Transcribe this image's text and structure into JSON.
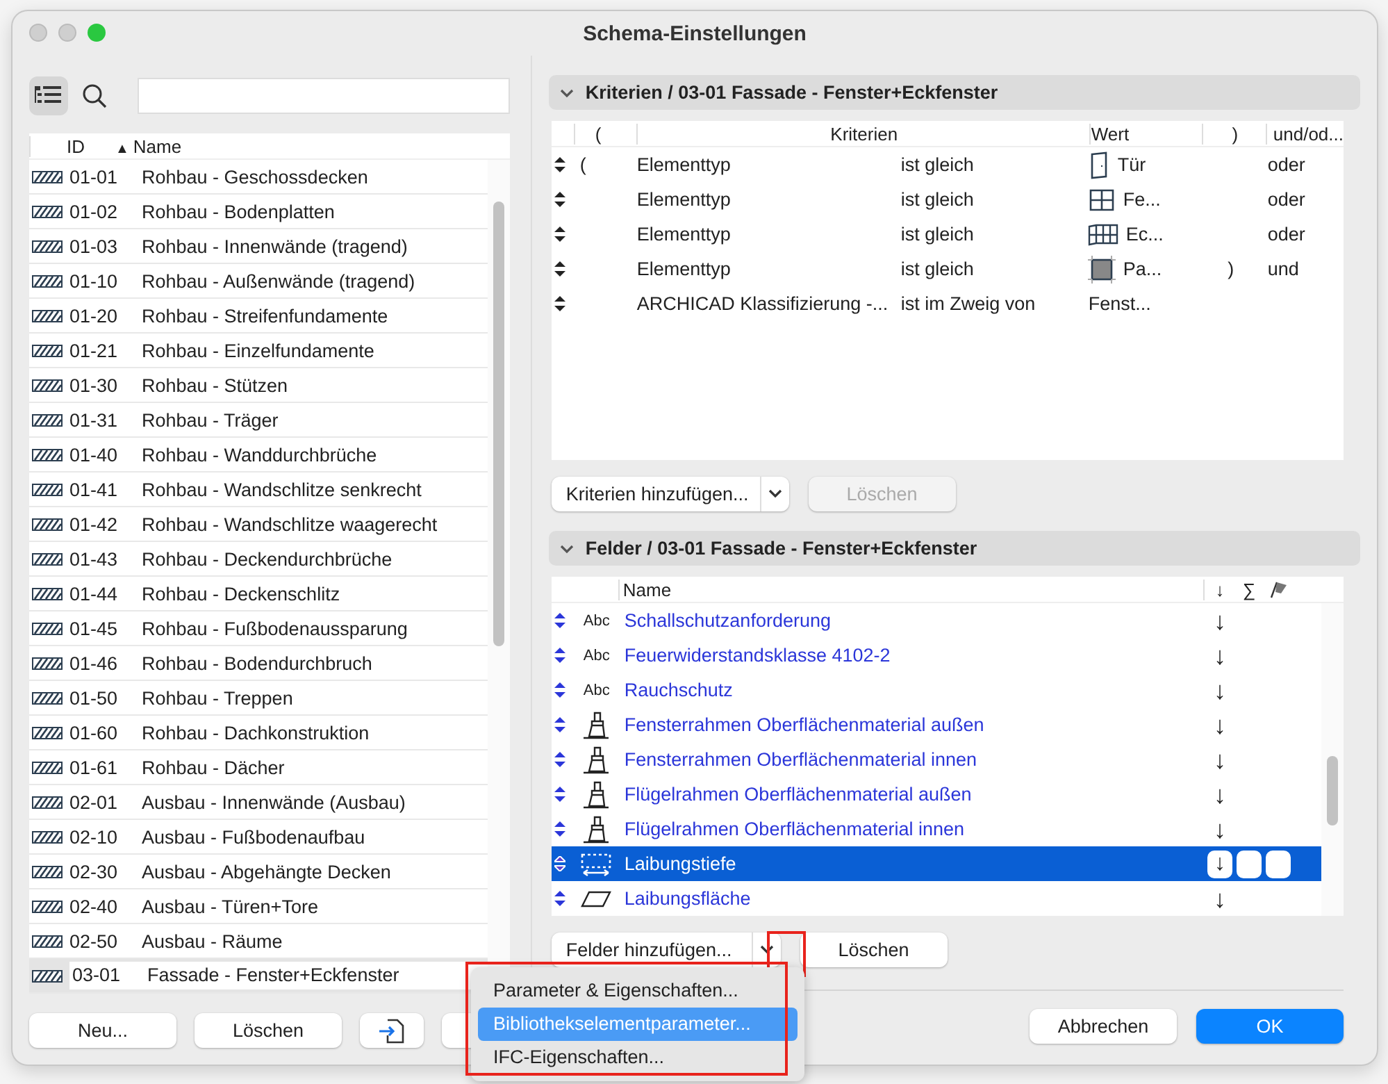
{
  "window": {
    "title": "Schema-Einstellungen"
  },
  "schemes": {
    "columns": [
      "ID",
      "Name"
    ],
    "sort_indicator": "▲",
    "rows": [
      {
        "id": "01-01",
        "name": "Rohbau - Geschossdecken",
        "selected": false
      },
      {
        "id": "01-02",
        "name": "Rohbau - Bodenplatten",
        "selected": false
      },
      {
        "id": "01-03",
        "name": "Rohbau - Innenwände (tragend)",
        "selected": false
      },
      {
        "id": "01-10",
        "name": "Rohbau - Außenwände (tragend)",
        "selected": false
      },
      {
        "id": "01-20",
        "name": "Rohbau - Streifenfundamente",
        "selected": false
      },
      {
        "id": "01-21",
        "name": "Rohbau - Einzelfundamente",
        "selected": false
      },
      {
        "id": "01-30",
        "name": "Rohbau - Stützen",
        "selected": false
      },
      {
        "id": "01-31",
        "name": "Rohbau - Träger",
        "selected": false
      },
      {
        "id": "01-40",
        "name": "Rohbau - Wanddurchbrüche",
        "selected": false
      },
      {
        "id": "01-41",
        "name": "Rohbau - Wandschlitze senkrecht",
        "selected": false
      },
      {
        "id": "01-42",
        "name": "Rohbau - Wandschlitze waagerecht",
        "selected": false
      },
      {
        "id": "01-43",
        "name": "Rohbau - Deckendurchbrüche",
        "selected": false
      },
      {
        "id": "01-44",
        "name": "Rohbau - Deckenschlitz",
        "selected": false
      },
      {
        "id": "01-45",
        "name": "Rohbau - Fußbodenaussparung",
        "selected": false
      },
      {
        "id": "01-46",
        "name": "Rohbau - Bodendurchbruch",
        "selected": false
      },
      {
        "id": "01-50",
        "name": "Rohbau - Treppen",
        "selected": false
      },
      {
        "id": "01-60",
        "name": "Rohbau - Dachkonstruktion",
        "selected": false
      },
      {
        "id": "01-61",
        "name": "Rohbau - Dächer",
        "selected": false
      },
      {
        "id": "02-01",
        "name": "Ausbau - Innenwände (Ausbau)",
        "selected": false
      },
      {
        "id": "02-10",
        "name": "Ausbau - Fußbodenaufbau",
        "selected": false
      },
      {
        "id": "02-30",
        "name": "Ausbau - Abgehängte Decken",
        "selected": false
      },
      {
        "id": "02-40",
        "name": "Ausbau - Türen+Tore",
        "selected": false
      },
      {
        "id": "02-50",
        "name": "Ausbau - Räume",
        "selected": false
      },
      {
        "id": "03-01",
        "name": "Fassade - Fenster+Eckfenster",
        "selected": true
      }
    ],
    "buttons": [
      "Neu...",
      "Löschen"
    ]
  },
  "criteria": {
    "title": "Kriterien / 03-01 Fassade - Fenster+Eckfenster",
    "columns": [
      "(",
      "Kriterien",
      "Wert",
      ")",
      "und/od..."
    ],
    "rows": [
      {
        "open": "(",
        "criterion": "Elementtyp",
        "operator": "ist gleich",
        "kind": "door",
        "value": "Tür",
        "close": "",
        "logic": "oder"
      },
      {
        "open": "",
        "criterion": "Elementtyp",
        "operator": "ist gleich",
        "kind": "window",
        "value": "Fe...",
        "close": "",
        "logic": "oder"
      },
      {
        "open": "",
        "criterion": "Elementtyp",
        "operator": "ist gleich",
        "kind": "corner-window",
        "value": "Ec...",
        "close": "",
        "logic": "oder"
      },
      {
        "open": "",
        "criterion": "Elementtyp",
        "operator": "ist gleich",
        "kind": "panel",
        "value": "Pa...",
        "close": ")",
        "logic": "und"
      },
      {
        "open": "",
        "criterion": "ARCHICAD Klassifizierung -...",
        "operator": "ist im Zweig von",
        "kind": "none",
        "value": "Fenst...",
        "close": "",
        "logic": ""
      }
    ],
    "add_button": "Kriterien hinzufügen...",
    "delete_button": "Löschen",
    "delete_disabled": true
  },
  "fields": {
    "title": "Felder / 03-01 Fassade - Fenster+Eckfenster",
    "columns": [
      "Name",
      "↓",
      "∑"
    ],
    "rows": [
      {
        "kind": "text",
        "type_label": "Abc",
        "name": "Schallschutzanforderung",
        "sort": "↓",
        "selected": false
      },
      {
        "kind": "text",
        "type_label": "Abc",
        "name": "Feuerwiderstandsklasse 4102-2",
        "sort": "↓",
        "selected": false
      },
      {
        "kind": "text",
        "type_label": "Abc",
        "name": "Rauchschutz",
        "sort": "↓",
        "selected": false
      },
      {
        "kind": "brush",
        "name": "Fensterrahmen Oberflächenmaterial außen",
        "sort": "↓",
        "selected": false
      },
      {
        "kind": "brush",
        "name": "Fensterrahmen Oberflächenmaterial innen",
        "sort": "↓",
        "selected": false
      },
      {
        "kind": "brush",
        "name": "Flügelrahmen Oberflächenmaterial außen",
        "sort": "↓",
        "selected": false
      },
      {
        "kind": "brush",
        "name": "Flügelrahmen Oberflächenmaterial innen",
        "sort": "↓",
        "selected": false
      },
      {
        "kind": "depth",
        "name": "Laibungstiefe",
        "sort": "↓",
        "selected": true
      },
      {
        "kind": "area",
        "name": "Laibungsfläche",
        "sort": "↓",
        "selected": false
      }
    ],
    "add_button": "Felder hinzufügen...",
    "delete_button": "Löschen"
  },
  "menu": {
    "items": [
      {
        "label": "Parameter & Eigenschaften...",
        "selected": false
      },
      {
        "label": "Bibliothekselementparameter...",
        "selected": true
      },
      {
        "label": "IFC-Eigenschaften...",
        "selected": false
      }
    ]
  },
  "dialog_buttons": [
    "Abbrechen",
    "OK"
  ]
}
